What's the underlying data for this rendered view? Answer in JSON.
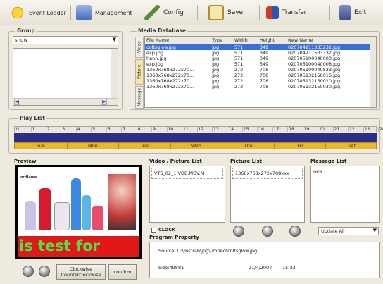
{
  "toolbar": {
    "event_loader": "Event Loader",
    "management": "Management",
    "config": "Config",
    "save": "Save",
    "transfer": "Transfer",
    "exit": "Exit"
  },
  "group": {
    "title": "Group",
    "dropdown_value": "show"
  },
  "media_db": {
    "title": "Media Database",
    "tabs": [
      "Video",
      "Picture",
      "Message"
    ],
    "columns": [
      "File Name",
      "Type",
      "Width",
      "Height",
      "New Name"
    ],
    "rows": [
      [
        "coltsglow.jpg",
        "jpg",
        "571",
        "349",
        "020704211333232.jpg"
      ],
      [
        "exp.jpg",
        "jpg",
        "571",
        "349",
        "020704211533332.jpg"
      ],
      [
        "hann.jpg",
        "jpg",
        "571",
        "349",
        "020705100040000.jpg"
      ],
      [
        "exp.jpg",
        "jpg",
        "571",
        "349",
        "020705100040008.jpg"
      ],
      [
        "1360x768x272x70...",
        "jpg",
        "272",
        "708",
        "020705100040833.jpg"
      ],
      [
        "1360x768x272x70...",
        "jpg",
        "272",
        "708",
        "020705132150016.jpg"
      ],
      [
        "1360x768x272x70...",
        "jpg",
        "272",
        "708",
        "020705132150020.jpg"
      ],
      [
        "1360x768x272x70...",
        "jpg",
        "272",
        "708",
        "020705132150030.jpg"
      ]
    ],
    "selected_row": 0
  },
  "playlist": {
    "title": "Play List",
    "hours": [
      "0",
      "1",
      "2",
      "3",
      "4",
      "5",
      "6",
      "7",
      "8",
      "9",
      "10",
      "11",
      "12",
      "13",
      "14",
      "15",
      "16",
      "17",
      "18",
      "19",
      "20",
      "21",
      "22",
      "23",
      "24"
    ],
    "days": [
      "Sun",
      "Mon",
      "Tue",
      "Wed",
      "Thu",
      "Fri",
      "Sat"
    ]
  },
  "preview": {
    "title": "Preview",
    "brand": "oriflame",
    "ticker": "is test for"
  },
  "video_list": {
    "title": "Video / Picture List",
    "item": "VTS_02_1.VOB.MOV.M"
  },
  "picture_list": {
    "title": "Picture List",
    "item": "1360x768x272x708xxx"
  },
  "message_list": {
    "title": "Message List",
    "item": "new"
  },
  "clock_label": "CLOCK",
  "update_select": "Update All",
  "program_property": {
    "title": "Program Property",
    "source": "Source:  D:\\mstrab\\jpg\\limited\\coltsglow.jpg",
    "size": "Size:49881",
    "date": "21/4/2007",
    "time": "15:33"
  },
  "clockwise_btn": "Clockwise\nCounterclockwise",
  "confirm_btn": "confirm",
  "colors": {
    "selection": "#3a6fd6",
    "timeline_dark": "#2b2f8c",
    "timeline_days": "#e9b82a",
    "ticker_green": "#4fe04a",
    "ticker_red": "#e01818"
  }
}
